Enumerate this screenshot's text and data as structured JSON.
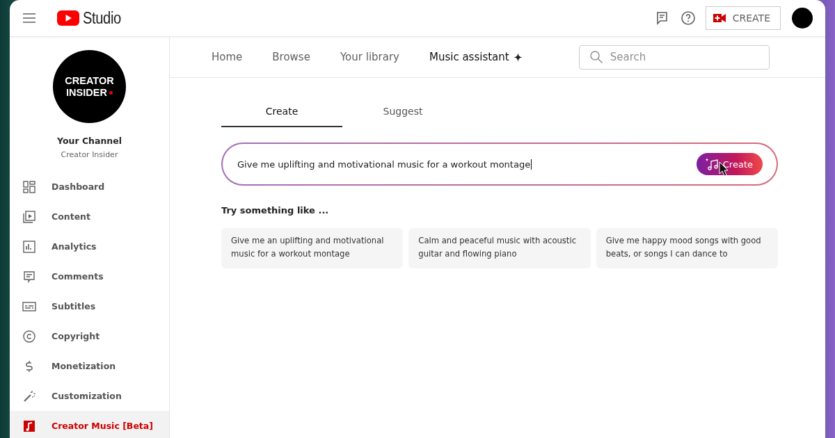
{
  "header": {
    "logo_text": "Studio",
    "create_button": "CREATE"
  },
  "channel": {
    "avatar_lines": [
      "CREATOR",
      "INSIDER"
    ],
    "title": "Your Channel",
    "name": "Creator Insider"
  },
  "sidebar": {
    "items": [
      {
        "kind": "dashboard",
        "label": "Dashboard",
        "selected": false
      },
      {
        "kind": "content",
        "label": "Content",
        "selected": false
      },
      {
        "kind": "analytics",
        "label": "Analytics",
        "selected": false
      },
      {
        "kind": "comments",
        "label": "Comments",
        "selected": false
      },
      {
        "kind": "subtitles",
        "label": "Subtitles",
        "selected": false
      },
      {
        "kind": "copyright",
        "label": "Copyright",
        "selected": false
      },
      {
        "kind": "monetization",
        "label": "Monetization",
        "selected": false
      },
      {
        "kind": "customization",
        "label": "Customization",
        "selected": false
      },
      {
        "kind": "music",
        "label": "Creator Music [Beta]",
        "selected": true
      }
    ]
  },
  "nav_tabs": [
    {
      "label": "Home",
      "selected": false,
      "sparkle": false
    },
    {
      "label": "Browse",
      "selected": false,
      "sparkle": false
    },
    {
      "label": "Your library",
      "selected": false,
      "sparkle": false
    },
    {
      "label": "Music assistant",
      "selected": true,
      "sparkle": true
    }
  ],
  "search": {
    "placeholder": "Search"
  },
  "mode_tabs": [
    {
      "label": "Create",
      "selected": true
    },
    {
      "label": "Suggest",
      "selected": false
    }
  ],
  "prompt": {
    "value": "Give me uplifting and motivational music for a workout montage",
    "button": "Create"
  },
  "suggestions": {
    "heading": "Try something like ...",
    "items": [
      "Give me an uplifting and motivational music for a workout montage",
      "Calm and peaceful music with acoustic guitar and flowing piano",
      "Give me happy mood songs with good beats, or songs I can dance to"
    ]
  }
}
